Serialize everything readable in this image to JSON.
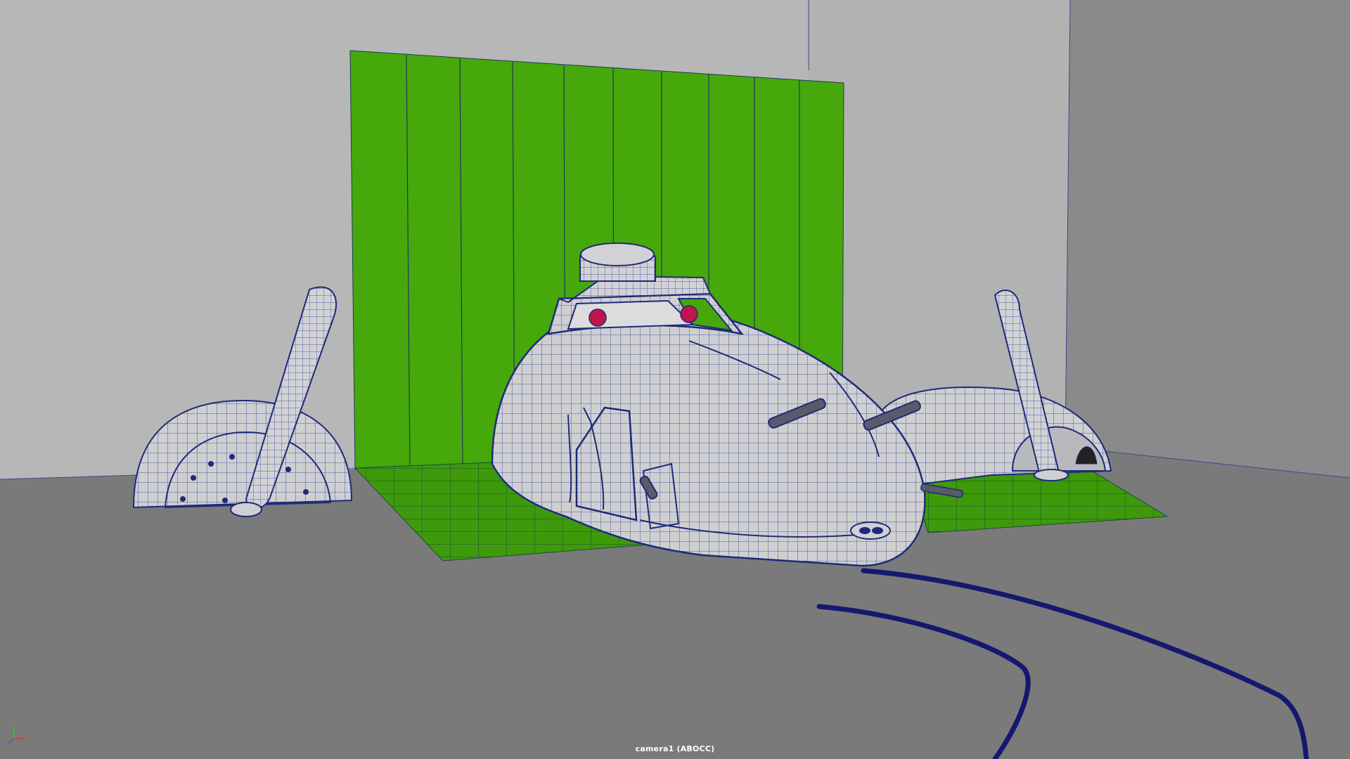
{
  "viewport": {
    "camera_label": "camera1 (ABOCC)",
    "colors": {
      "background_floor": "#7a7a7a",
      "wall_left": "#b6b6b6",
      "wall_right": "#9a9a9a",
      "green_screen": "#46a80a",
      "green_floor": "#3e9a0a",
      "wireframe": "#1e2a78",
      "mesh_surface": "#cfcfd2",
      "curve": "#14186e",
      "cockpit_accent": "#c0154a"
    }
  },
  "gizmo": {
    "axes": [
      "x-axis",
      "y-axis",
      "z-axis"
    ],
    "colors": {
      "x": "#d23a3a",
      "y": "#3ac23a",
      "z": "#3a5ad2"
    }
  }
}
